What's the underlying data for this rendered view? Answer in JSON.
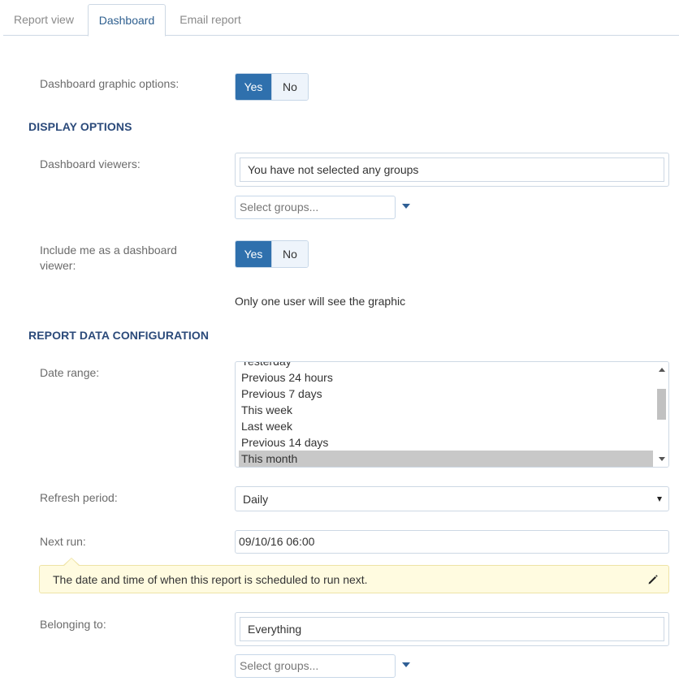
{
  "tabs": [
    {
      "label": "Report view",
      "active": false
    },
    {
      "label": "Dashboard",
      "active": true
    },
    {
      "label": "Email report",
      "active": false
    }
  ],
  "dashboard_graphic": {
    "label": "Dashboard graphic options:",
    "yes": "Yes",
    "no": "No",
    "selected": "Yes"
  },
  "display_options": {
    "heading": "DISPLAY OPTIONS",
    "viewers": {
      "label": "Dashboard viewers:",
      "value": "You have not selected any groups",
      "select_placeholder": "Select groups..."
    },
    "include_me": {
      "label_line1": "Include me as a dashboard",
      "label_line2": "viewer:",
      "yes": "Yes",
      "no": "No",
      "selected": "Yes"
    },
    "note": "Only one user will see the graphic"
  },
  "report_data": {
    "heading": "REPORT DATA CONFIGURATION",
    "date_range": {
      "label": "Date range:",
      "options": [
        "Yesterday",
        "Previous 24 hours",
        "Previous 7 days",
        "This week",
        "Last week",
        "Previous 14 days",
        "This month"
      ],
      "selected": "This month"
    },
    "refresh": {
      "label": "Refresh period:",
      "value": "Daily"
    },
    "next_run": {
      "label": "Next run:",
      "value": "09/10/16 06:00",
      "tooltip": "The date and time of when this report is scheduled to run next."
    },
    "belonging": {
      "label": "Belonging to:",
      "value": "Everything",
      "select_placeholder": "Select groups..."
    }
  },
  "colors": {
    "accent": "#2f70ad",
    "heading": "#2b4a7a",
    "tooltip_bg": "#fffbe0"
  }
}
